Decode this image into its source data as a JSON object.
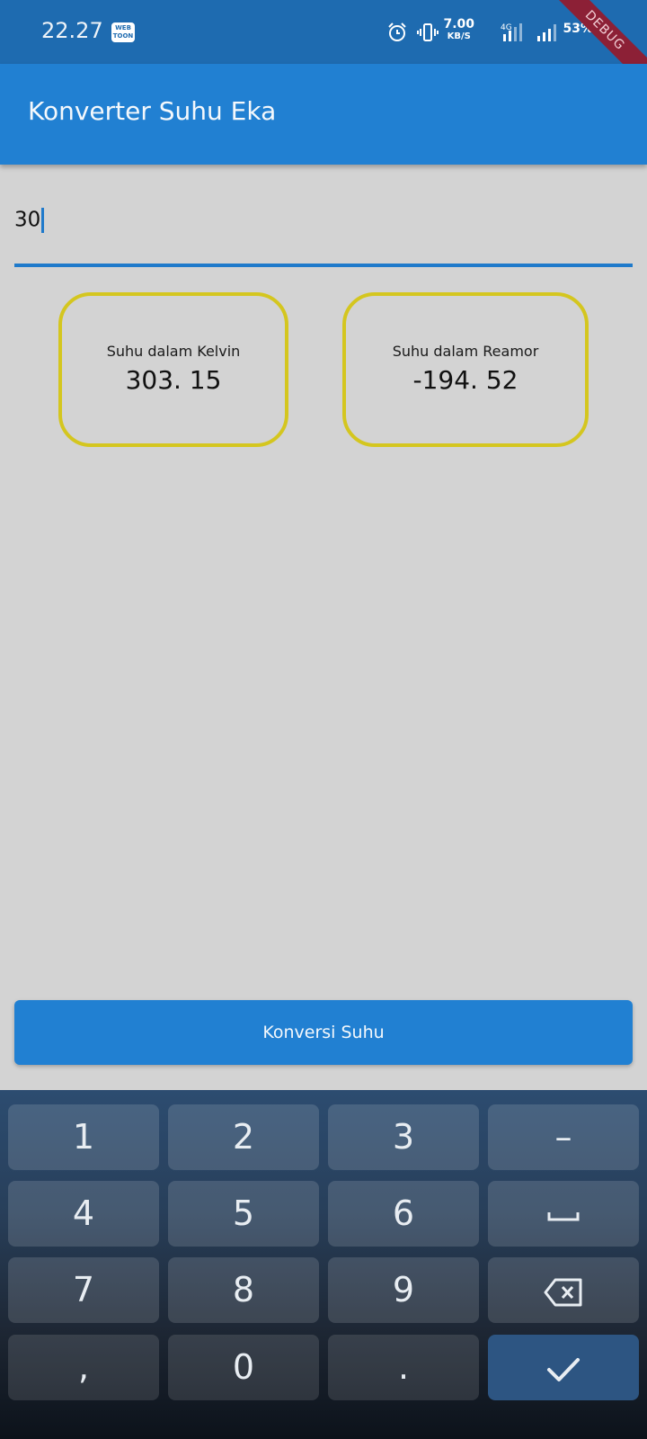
{
  "status_bar": {
    "time": "22.27",
    "webtoon_icon": "webtoon-icon",
    "webtoon_text_1": "WEB",
    "webtoon_text_2": "TOON",
    "speed_value": "7.00",
    "speed_unit": "KB/S",
    "network_label": "4G",
    "battery": "53%"
  },
  "debug_banner": "DEBUG",
  "app_bar": {
    "title": "Konverter Suhu Eka"
  },
  "input": {
    "value": "30"
  },
  "results": {
    "kelvin_label": "Suhu dalam Kelvin",
    "kelvin_value": "303. 15",
    "reamor_label": "Suhu dalam Reamor",
    "reamor_value": "-194. 52"
  },
  "convert_button": {
    "label": "Konversi Suhu"
  },
  "keyboard": {
    "rows": [
      [
        "1",
        "2",
        "3",
        "–"
      ],
      [
        "4",
        "5",
        "6",
        "␣"
      ],
      [
        "7",
        "8",
        "9",
        "backspace"
      ],
      [
        ",",
        "0",
        ".",
        "done"
      ]
    ]
  },
  "colors": {
    "app_bar": "#2180d2",
    "status_bar": "#1e6bb0",
    "card_border": "#d4c61f",
    "background": "#d3d3d3"
  }
}
